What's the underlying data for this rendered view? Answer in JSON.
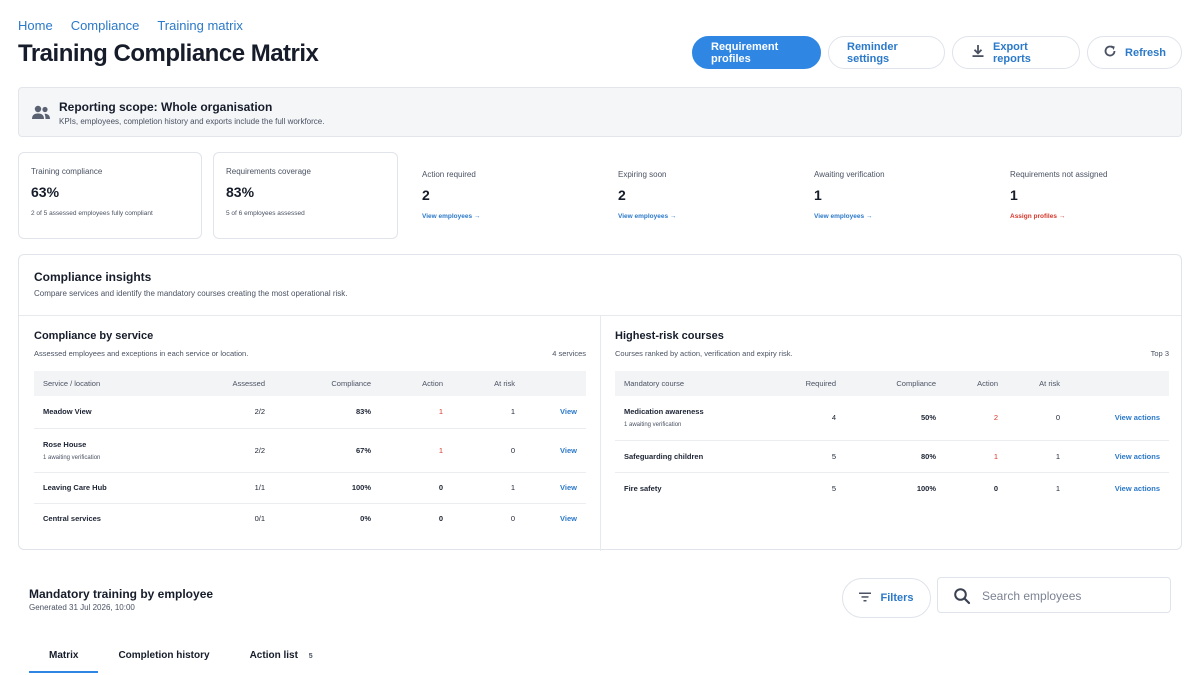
{
  "breadcrumb": [
    "Home",
    "Compliance",
    "Training matrix"
  ],
  "page_title": "Training Compliance Matrix",
  "toolbar": {
    "requirement_profiles": "Requirement profiles",
    "reminder_settings": "Reminder settings",
    "export_reports": "Export reports",
    "refresh": "Refresh"
  },
  "scope": {
    "title": "Reporting scope: Whole organisation",
    "subtitle": "KPIs, employees, completion history and exports include the full workforce."
  },
  "kpis": {
    "training_compliance": {
      "label": "Training compliance",
      "value": "63%",
      "sub": "2 of 5 assessed employees fully compliant"
    },
    "requirements_coverage": {
      "label": "Requirements coverage",
      "value": "83%",
      "sub": "5 of 6 employees assessed"
    },
    "action_required": {
      "label": "Action required",
      "value": "2",
      "link": "View employees →"
    },
    "expiring_soon": {
      "label": "Expiring soon",
      "value": "2",
      "link": "View employees →"
    },
    "awaiting_verification": {
      "label": "Awaiting verification",
      "value": "1",
      "link": "View employees →"
    },
    "requirements_not_assigned": {
      "label": "Requirements not assigned",
      "value": "1",
      "link": "Assign profiles →"
    }
  },
  "insights": {
    "title": "Compliance insights",
    "subtitle": "Compare services and identify the mandatory courses creating the most operational risk.",
    "by_service": {
      "title": "Compliance by service",
      "subtitle": "Assessed employees and exceptions in each service or location.",
      "count": "4 services",
      "headers": [
        "Service / location",
        "Assessed",
        "Compliance",
        "Action",
        "At risk",
        ""
      ],
      "rows": [
        {
          "name": "Meadow View",
          "note": "",
          "assessed": "2/2",
          "compliance": "83%",
          "action": "1",
          "at_risk": "1",
          "link": "View"
        },
        {
          "name": "Rose House",
          "note": "1 awaiting verification",
          "assessed": "2/2",
          "compliance": "67%",
          "action": "1",
          "at_risk": "0",
          "link": "View"
        },
        {
          "name": "Leaving Care Hub",
          "note": "",
          "assessed": "1/1",
          "compliance": "100%",
          "action": "0",
          "at_risk": "1",
          "link": "View"
        },
        {
          "name": "Central services",
          "note": "",
          "assessed": "0/1",
          "compliance": "0%",
          "action": "0",
          "at_risk": "0",
          "link": "View"
        }
      ]
    },
    "risk_courses": {
      "title": "Highest-risk courses",
      "subtitle": "Courses ranked by action, verification and expiry risk.",
      "count": "Top 3",
      "headers": [
        "Mandatory course",
        "Required",
        "Compliance",
        "Action",
        "At risk",
        ""
      ],
      "rows": [
        {
          "name": "Medication awareness",
          "note": "1 awaiting verification",
          "required": "4",
          "compliance": "50%",
          "action": "2",
          "at_risk": "0",
          "link": "View actions"
        },
        {
          "name": "Safeguarding children",
          "note": "",
          "required": "5",
          "compliance": "80%",
          "action": "1",
          "at_risk": "1",
          "link": "View actions"
        },
        {
          "name": "Fire safety",
          "note": "",
          "required": "5",
          "compliance": "100%",
          "action": "0",
          "at_risk": "1",
          "link": "View actions"
        }
      ]
    }
  },
  "employees": {
    "title": "Mandatory training by employee",
    "generated": "Generated 31 Jul 2026, 10:00",
    "filters_label": "Filters",
    "search_placeholder": "Search employees",
    "tabs": [
      {
        "label": "Matrix",
        "badge": ""
      },
      {
        "label": "Completion history",
        "badge": ""
      },
      {
        "label": "Action list",
        "badge": "5"
      }
    ]
  },
  "colors": {
    "accent": "#2f86e3",
    "link": "#2b79c9",
    "danger": "#d6372b"
  },
  "icons": [
    "people-icon",
    "download-icon",
    "refresh-icon",
    "filter-icon",
    "search-icon"
  ]
}
